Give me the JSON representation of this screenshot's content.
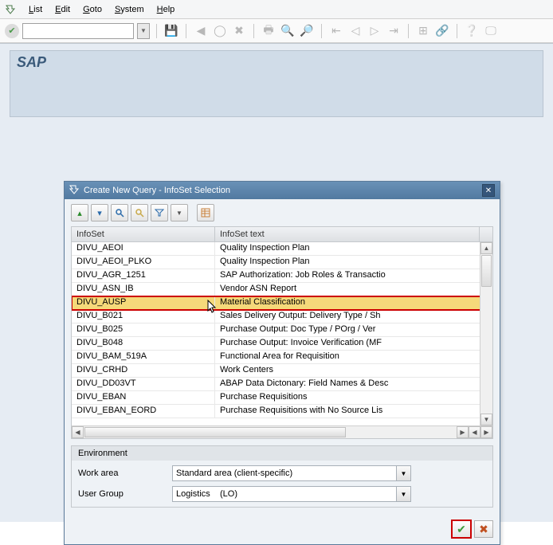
{
  "menubar": {
    "items": [
      {
        "u": "L",
        "rest": "ist"
      },
      {
        "u": "E",
        "rest": "dit"
      },
      {
        "u": "G",
        "rest": "oto"
      },
      {
        "u": "S",
        "rest": "ystem"
      },
      {
        "u": "H",
        "rest": "elp"
      }
    ]
  },
  "toolbar": {
    "command_value": ""
  },
  "brand": "SAP",
  "dialog": {
    "title": "Create New Query - InfoSet Selection",
    "columns": {
      "c1": "InfoSet",
      "c2": "InfoSet text"
    },
    "rows": [
      {
        "c1": "DIVU_AEOI",
        "c2": "Quality Inspection Plan",
        "sel": false
      },
      {
        "c1": "DIVU_AEOI_PLKO",
        "c2": "Quality Inspection Plan",
        "sel": false
      },
      {
        "c1": "DIVU_AGR_1251",
        "c2": "SAP Authorization: Job Roles & Transactio",
        "sel": false
      },
      {
        "c1": "DIVU_ASN_IB",
        "c2": "Vendor ASN Report",
        "sel": false
      },
      {
        "c1": "DIVU_AUSP",
        "c2": "Material Classification",
        "sel": true
      },
      {
        "c1": "DIVU_B021",
        "c2": "Sales Delivery Output: Delivery Type / Sh",
        "sel": false
      },
      {
        "c1": "DIVU_B025",
        "c2": "Purchase Output: Doc Type / POrg / Ver",
        "sel": false
      },
      {
        "c1": "DIVU_B048",
        "c2": "Purchase Output: Invoice Verification (MF",
        "sel": false
      },
      {
        "c1": "DIVU_BAM_519A",
        "c2": "Functional Area for Requisition",
        "sel": false
      },
      {
        "c1": "DIVU_CRHD",
        "c2": "Work Centers",
        "sel": false
      },
      {
        "c1": "DIVU_DD03VT",
        "c2": "ABAP Data Dictonary: Field Names & Desc",
        "sel": false
      },
      {
        "c1": "DIVU_EBAN",
        "c2": "Purchase Requisitions",
        "sel": false
      },
      {
        "c1": "DIVU_EBAN_EORD",
        "c2": "Purchase Requisitions with No Source Lis",
        "sel": false
      }
    ],
    "environment": {
      "title": "Environment",
      "work_area_label": "Work area",
      "work_area_value": "Standard area (client-specific)",
      "user_group_label": "User Group",
      "user_group_value": "Logistics    (LO)"
    }
  }
}
